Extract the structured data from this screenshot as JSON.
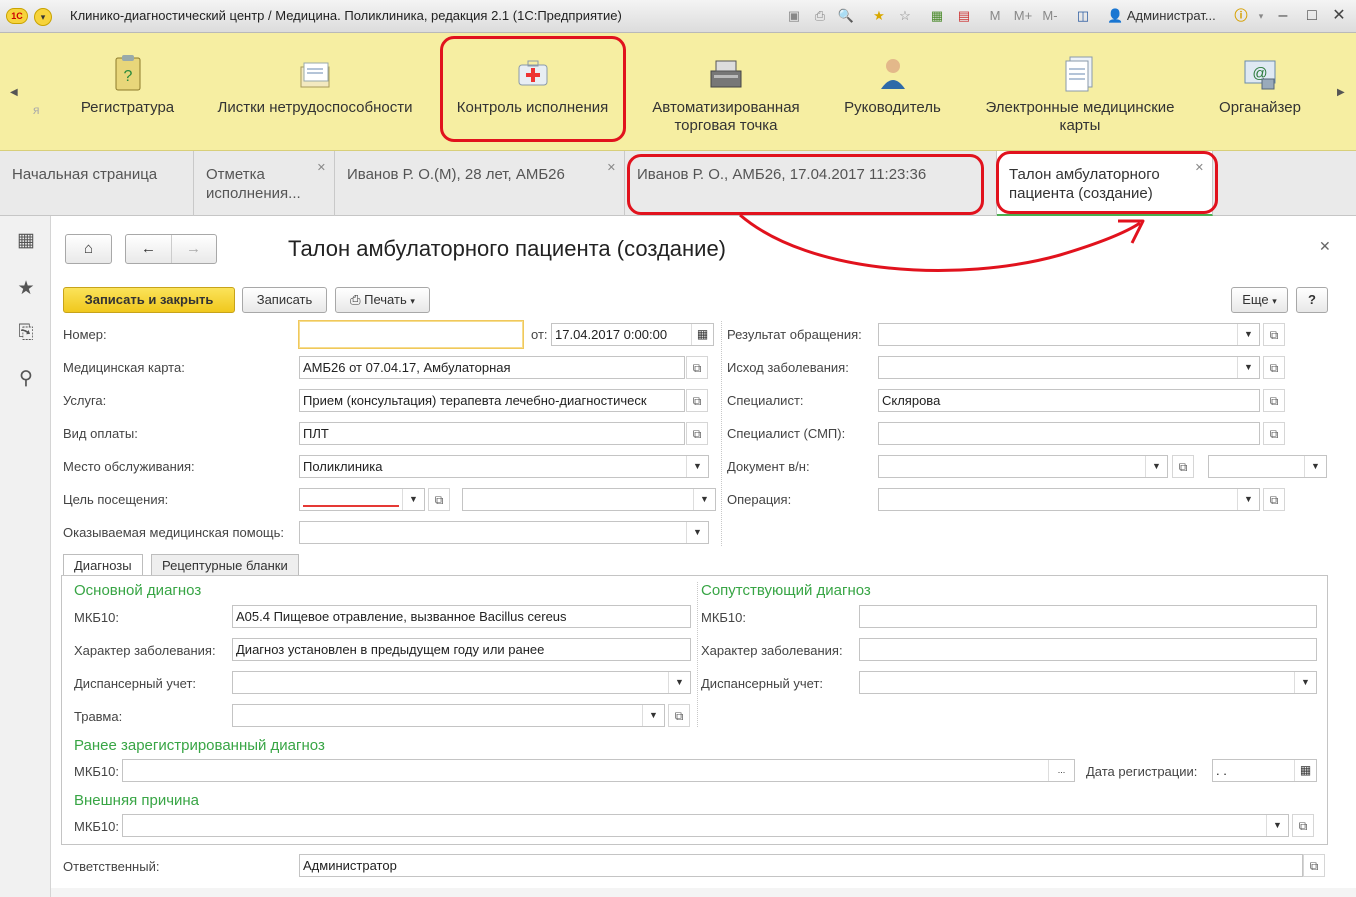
{
  "titlebar": {
    "app_title": "Клинико-диагностический центр / Медицина. Поликлиника, редакция 2.1  (1С:Предприятие)",
    "logo_text": "1С",
    "user": "Администрат...",
    "m_labels": [
      "M",
      "M+",
      "M-"
    ]
  },
  "sections": {
    "items": [
      {
        "label": "Регистратура",
        "icon": "clipboard-question-icon"
      },
      {
        "label": "Листки нетрудоспособности",
        "icon": "documents-icon"
      },
      {
        "label": "Контроль исполнения",
        "icon": "medical-kit-icon"
      },
      {
        "label": "Автоматизированная торговая точка",
        "icon": "cash-register-icon"
      },
      {
        "label": "Руководитель",
        "icon": "manager-icon"
      },
      {
        "label": "Электронные медицинские карты",
        "icon": "medical-cards-icon"
      },
      {
        "label": "Органайзер",
        "icon": "organizer-icon"
      }
    ],
    "hidden_prefix": "я"
  },
  "tabs": [
    {
      "label": "Начальная страница"
    },
    {
      "label": "Отметка исполнения..."
    },
    {
      "label": "Иванов Р. О.(М), 28 лет, АМБ26"
    },
    {
      "label": "Иванов Р. О., АМБ26, 17.04.2017 11:23:36"
    },
    {
      "label": "Талон амбулаторного пациента (создание)"
    }
  ],
  "form": {
    "title": "Талон амбулаторного пациента (создание)",
    "buttons": {
      "save_close": "Записать и закрыть",
      "save": "Записать",
      "print": "Печать",
      "more": "Еще",
      "help": "?"
    },
    "left": {
      "number_label": "Номер:",
      "number_value": "",
      "from_label": "от:",
      "from_value": "17.04.2017  0:00:00",
      "card_label": "Медицинская карта:",
      "card_value": "АМБ26 от 07.04.17, Амбулаторная",
      "service_label": "Услуга:",
      "service_value": "Прием (консультация) терапевта лечебно-диагностическ",
      "payment_label": "Вид оплаты:",
      "payment_value": "ПЛТ",
      "place_label": "Место обслуживания:",
      "place_value": "Поликлиника",
      "purpose_label": "Цель посещения:",
      "purpose_value": "",
      "purpose_value2": "",
      "care_label": "Оказываемая медицинская помощь:",
      "care_value": ""
    },
    "right": {
      "result_label": "Результат обращения:",
      "result_value": "",
      "outcome_label": "Исход заболевания:",
      "outcome_value": "",
      "specialist_label": "Специалист:",
      "specialist_value": "Склярова",
      "specialist_smp_label": "Специалист (СМП):",
      "specialist_smp_value": "",
      "document_label": "Документ в/н:",
      "document_value": "",
      "document_value2": "",
      "operation_label": "Операция:",
      "operation_value": ""
    },
    "inner_tabs": [
      "Диагнозы",
      "Рецептурные бланки"
    ],
    "main_diag": {
      "heading": "Основной диагноз",
      "mkb_label": "МКБ10:",
      "mkb_value": "A05.4 Пищевое отравление, вызванное Bacillus cereus",
      "character_label": "Характер заболевания:",
      "character_value": "Диагноз установлен в предыдущем году или ранее",
      "dispensary_label": "Диспансерный учет:",
      "dispensary_value": "",
      "trauma_label": "Травма:",
      "trauma_value": ""
    },
    "concomitant": {
      "heading": "Сопутствующий диагноз",
      "mkb_label": "МКБ10:",
      "mkb_value": "",
      "character_label": "Характер заболевания:",
      "character_value": "",
      "dispensary_label": "Диспансерный учет:",
      "dispensary_value": ""
    },
    "previous": {
      "heading": "Ранее зарегистрированный диагноз",
      "mkb_label": "МКБ10:",
      "mkb_value": "",
      "ellipsis": "...",
      "date_label": "Дата регистрации:",
      "date_value": " .  ."
    },
    "external": {
      "heading": "Внешняя причина",
      "mkb_label": "МКБ10:",
      "mkb_value": ""
    },
    "responsible_label": "Ответственный:",
    "responsible_value": "Администратор"
  },
  "annotation_color": "#e1121d",
  "section_bg": "#f6eea2",
  "accent_green": "#38a545"
}
